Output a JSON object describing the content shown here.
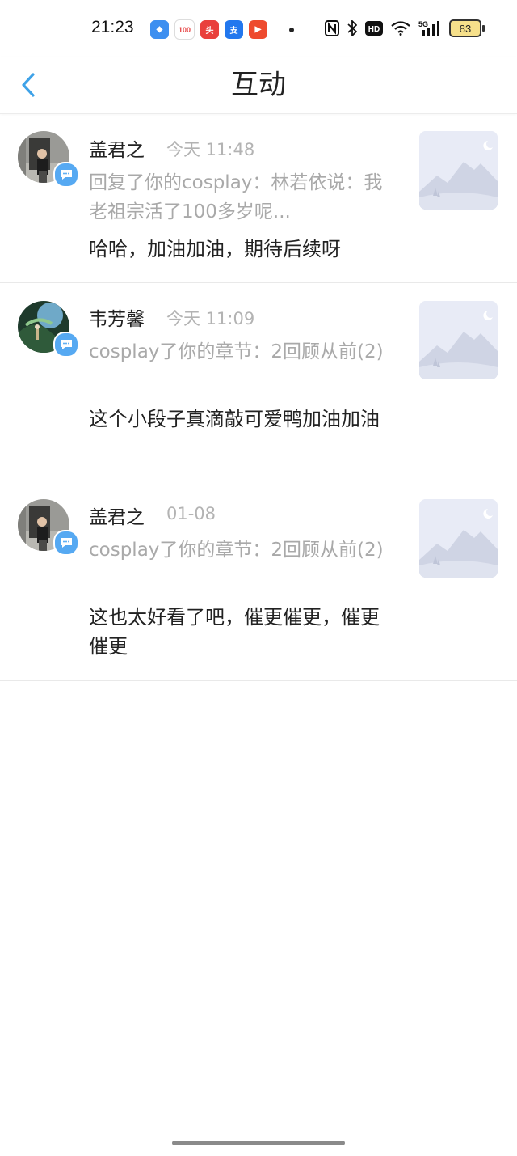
{
  "status": {
    "time": "21:23",
    "battery": "83",
    "network": "5G"
  },
  "header": {
    "title": "互动",
    "back_icon": "chevron-left-icon",
    "accent": "#3ea2e8"
  },
  "items": [
    {
      "name": "盖君之",
      "time": "今天 11:48",
      "reference": "回复了你的cosplay：林若依说：我老祖宗活了100多岁呢...",
      "comment": "哈哈，加油加油，期待后续呀"
    },
    {
      "name": "韦芳馨",
      "time": "今天 11:09",
      "reference": "cosplay了你的章节：2回顾从前(2)",
      "comment": "这个小段子真滴敲可爱鸭加油加油"
    },
    {
      "name": "盖君之",
      "time": "01-08",
      "reference": "cosplay了你的章节：2回顾从前(2)",
      "comment": "这也太好看了吧，催更催更，催更催更"
    }
  ]
}
